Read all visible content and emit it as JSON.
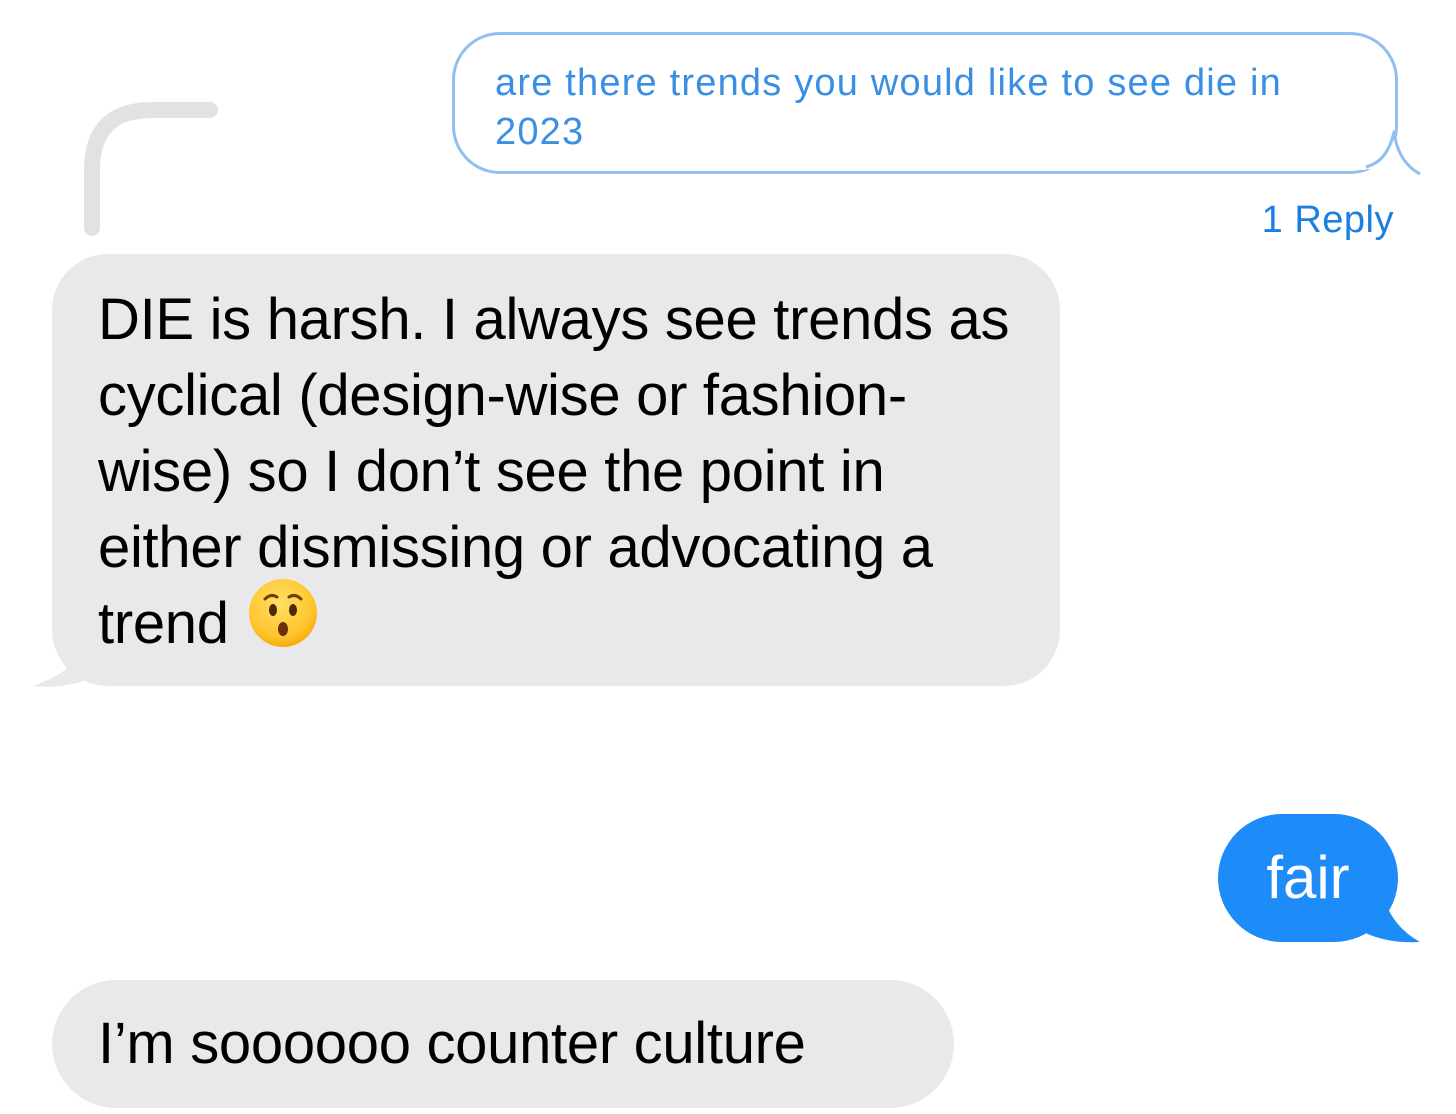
{
  "thread": {
    "quoted_message": "are there trends you would like to see die in 2023",
    "reply_count": "1 Reply"
  },
  "messages": [
    {
      "direction": "incoming",
      "text": "DIE is harsh. I always see trends as cyclical (design-wise or fashion-wise) so I don’t see the point in either dismissing or advocating a trend",
      "emoji": "hushed-face"
    },
    {
      "direction": "outgoing",
      "text": "fair"
    },
    {
      "direction": "incoming",
      "text": "I’m soooooo counter culture"
    }
  ],
  "colors": {
    "incoming_bubble": "#e9e9eb",
    "outgoing_bubble": "#1d8cf8",
    "quoted_outline": "#8fc0ef",
    "quoted_text": "#3a8fe4",
    "reply_link": "#1a7fe0",
    "thread_line": "#e2e2e4"
  }
}
